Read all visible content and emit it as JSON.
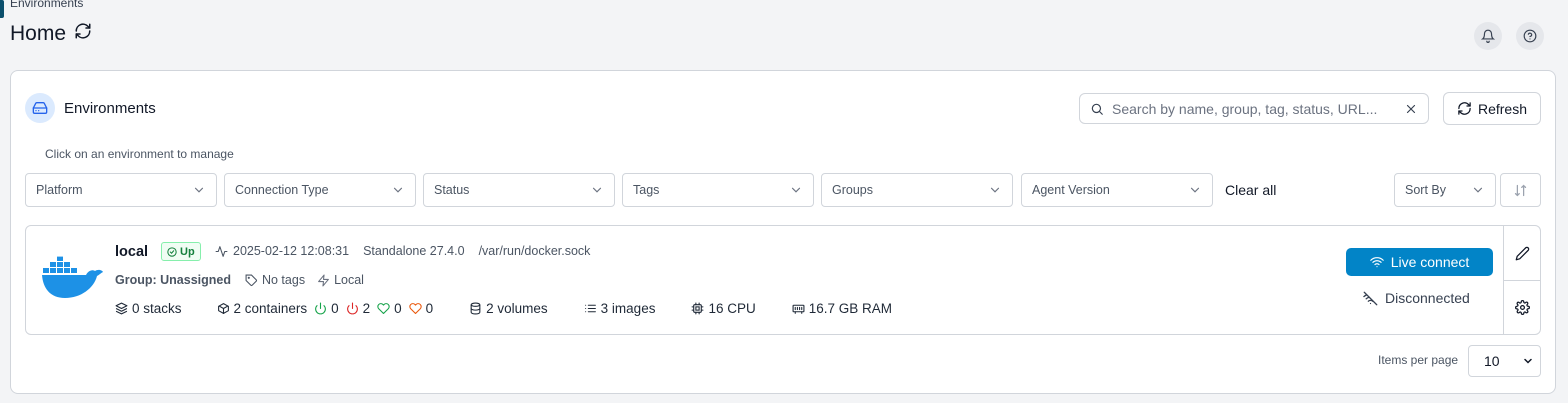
{
  "breadcrumb": "Environments",
  "page_title": "Home",
  "section": {
    "title": "Environments",
    "hint": "Click on an environment to manage"
  },
  "search": {
    "placeholder": "Search by name, group, tag, status, URL..."
  },
  "refresh_label": "Refresh",
  "filters": [
    "Platform",
    "Connection Type",
    "Status",
    "Tags",
    "Groups",
    "Agent Version"
  ],
  "clear_all": "Clear all",
  "sort_by": "Sort By",
  "environment": {
    "name": "local",
    "status": "Up",
    "timestamp": "2025-02-12 12:08:31",
    "type": "Standalone 27.4.0",
    "url": "/var/run/docker.sock",
    "group": "Group: Unassigned",
    "tags": "No tags",
    "agent": "Local",
    "stacks": "0 stacks",
    "containers": "2 containers",
    "running": "0",
    "stopped": "2",
    "healthy": "0",
    "unhealthy": "0",
    "volumes": "2 volumes",
    "images": "3 images",
    "cpu": "16 CPU",
    "ram": "16.7 GB RAM",
    "live_connect": "Live connect",
    "connection": "Disconnected"
  },
  "pagination": {
    "label": "Items per page",
    "value": "10"
  },
  "colors": {
    "accent": "#0284c7",
    "up": "#15803d",
    "running": "#16a34a",
    "stopped": "#dc2626",
    "healthy": "#16a34a",
    "unhealthy": "#ea580c",
    "docker": "#1d91e6"
  }
}
